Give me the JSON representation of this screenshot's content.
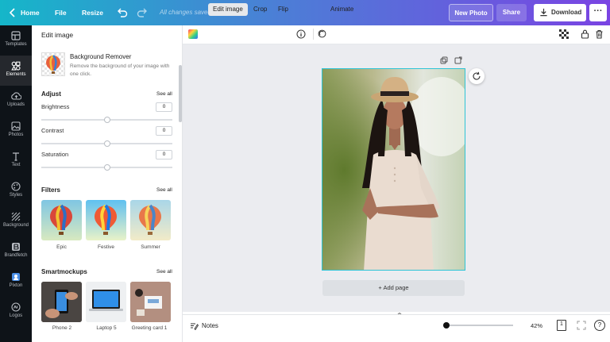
{
  "topbar": {
    "home_label": "Home",
    "file_label": "File",
    "resize_label": "Resize",
    "autosave_status": "All changes saved",
    "new_photo_label": "New Photo",
    "share_label": "Share",
    "download_label": "Download",
    "more_label": "···"
  },
  "rail": {
    "items": [
      {
        "label": "Templates",
        "icon": "templates-icon"
      },
      {
        "label": "Elements",
        "icon": "elements-icon"
      },
      {
        "label": "Uploads",
        "icon": "uploads-icon"
      },
      {
        "label": "Photos",
        "icon": "photos-icon"
      },
      {
        "label": "Text",
        "icon": "text-icon"
      },
      {
        "label": "Styles",
        "icon": "styles-icon"
      },
      {
        "label": "Background",
        "icon": "background-icon"
      },
      {
        "label": "Brandfetch",
        "icon": "brandfetch-icon"
      },
      {
        "label": "Pixton",
        "icon": "pixton-icon"
      },
      {
        "label": "Logos",
        "icon": "logos-icon"
      }
    ]
  },
  "panel": {
    "title": "Edit image",
    "bg_remover": {
      "title": "Background Remover",
      "description": "Remove the background of your image with one click."
    },
    "adjust": {
      "heading": "Adjust",
      "see_all": "See all",
      "items": [
        {
          "label": "Brightness",
          "value": "0"
        },
        {
          "label": "Contrast",
          "value": "0"
        },
        {
          "label": "Saturation",
          "value": "0"
        }
      ]
    },
    "filters": {
      "heading": "Filters",
      "see_all": "See all",
      "items": [
        "Epic",
        "Festive",
        "Summer"
      ]
    },
    "smartmockups": {
      "heading": "Smartmockups",
      "see_all": "See all",
      "items": [
        "Phone 2",
        "Laptop 5",
        "Greeting card 1"
      ]
    }
  },
  "context_toolbar": {
    "edit_image": "Edit image",
    "crop": "Crop",
    "flip": "Flip",
    "animate": "Animate"
  },
  "canvas": {
    "add_page_label": "+ Add page"
  },
  "bottombar": {
    "notes_label": "Notes",
    "zoom_level": "42%",
    "page_count": "1",
    "help_label": "?"
  },
  "colors": {
    "accent": "#2ec4d6",
    "gradient_start": "#15b6c9",
    "gradient_end": "#7a44e3"
  }
}
